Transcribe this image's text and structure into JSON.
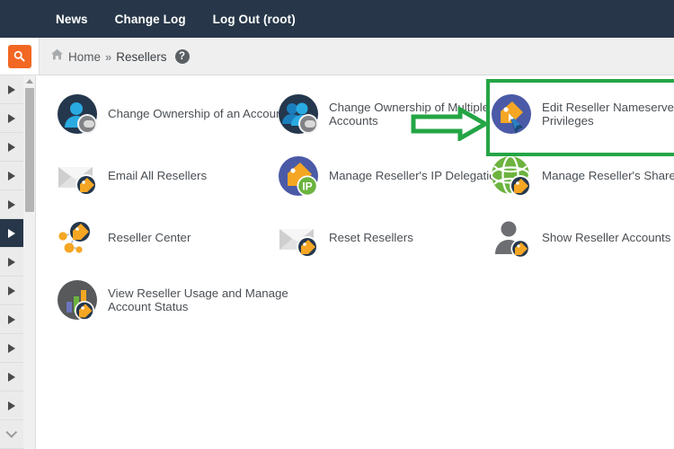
{
  "topnav": {
    "links": [
      {
        "label": "News",
        "name": "nav-news"
      },
      {
        "label": "Change Log",
        "name": "nav-change-log"
      },
      {
        "label": "Log Out (root)",
        "name": "nav-log-out"
      }
    ]
  },
  "breadcrumb": {
    "home_label": "Home",
    "separator": "»",
    "current_label": "Resellers",
    "help_glyph": "?"
  },
  "search": {
    "icon": "search-icon"
  },
  "sidebar": {
    "items": [
      {
        "icon": "play-triangle-icon",
        "active": false
      },
      {
        "icon": "play-triangle-icon",
        "active": false
      },
      {
        "icon": "play-triangle-icon",
        "active": false
      },
      {
        "icon": "play-triangle-icon",
        "active": false
      },
      {
        "icon": "play-triangle-icon",
        "active": false
      },
      {
        "icon": "play-triangle-icon",
        "active": true
      },
      {
        "icon": "play-triangle-icon",
        "active": false
      },
      {
        "icon": "play-triangle-icon",
        "active": false
      },
      {
        "icon": "play-triangle-icon",
        "active": false
      },
      {
        "icon": "play-triangle-icon",
        "active": false
      },
      {
        "icon": "play-triangle-icon",
        "active": false
      },
      {
        "icon": "play-triangle-icon",
        "active": false
      },
      {
        "icon": "play-triangle-icon",
        "active": false
      }
    ],
    "scroll_down_icon": "chevron-down-icon",
    "scroll_up_icon": "chevron-up-icon"
  },
  "main": {
    "rows": [
      {
        "cells": [
          {
            "label": "Change Ownership of an Account",
            "icon": "single-user-icon",
            "name": "tile-change-ownership-of-an-account"
          },
          {
            "label": "Change Ownership of Multiple\nAccounts",
            "icon": "multiple-users-icon",
            "name": "tile-change-ownership-of-multiple-accounts"
          },
          {
            "label": "Edit Reseller Nameservers a\nPrivileges",
            "icon": "edit-tag-cursor-icon",
            "name": "tile-edit-reseller-nameservers-and-privileges"
          }
        ]
      },
      {
        "cells": [
          {
            "label": "Email All Resellers",
            "icon": "envelope-tag-icon",
            "name": "tile-email-all-resellers"
          },
          {
            "label": "Manage Reseller's IP Delegation",
            "icon": "tag-ip-icon",
            "name": "tile-manage-resellers-ip-delegation"
          },
          {
            "label": "Manage Reseller's Shared II",
            "icon": "globe-tag-icon",
            "name": "tile-manage-resellers-shared-ip"
          }
        ]
      },
      {
        "cells": [
          {
            "label": "Reseller Center",
            "icon": "network-tag-icon",
            "name": "tile-reseller-center"
          },
          {
            "label": "Reset Resellers",
            "icon": "envelope-tag-icon",
            "name": "tile-reset-resellers"
          },
          {
            "label": "Show Reseller Accounts",
            "icon": "user-silhouette-tag-icon",
            "name": "tile-show-reseller-accounts"
          }
        ]
      },
      {
        "cells": [
          {
            "label": "View Reseller Usage and Manage\nAccount Status",
            "icon": "bar-chart-tag-icon",
            "name": "tile-view-reseller-usage-and-manage-account-status"
          }
        ]
      }
    ]
  },
  "annotations": {
    "highlight_color": "#24a546",
    "arrow_icon": "green-right-arrow-annotation",
    "box_name": "green-highlight-box-annotation"
  },
  "colors": {
    "topnav_bg": "#273749",
    "crumbbar_bg": "#efefef",
    "accent_orange": "#f26722",
    "sidebar_active": "#273749",
    "annotation_green": "#24a546"
  }
}
